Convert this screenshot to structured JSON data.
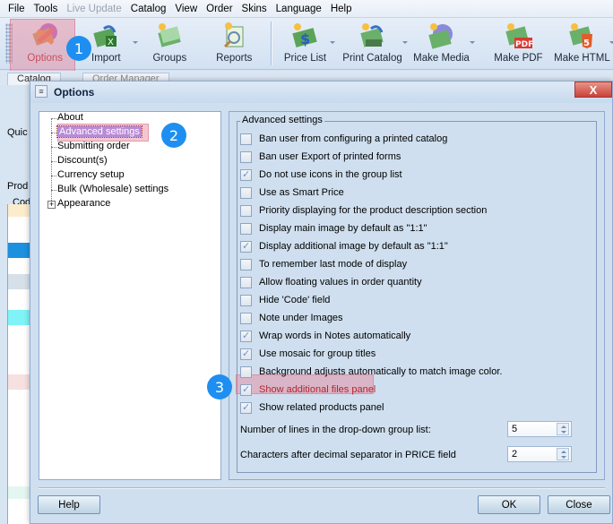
{
  "menubar": {
    "items": [
      {
        "label": "File",
        "enabled": true
      },
      {
        "label": "Tools",
        "enabled": true
      },
      {
        "label": "Live Update",
        "enabled": false
      },
      {
        "label": "Catalog",
        "enabled": true
      },
      {
        "label": "View",
        "enabled": true
      },
      {
        "label": "Order",
        "enabled": true
      },
      {
        "label": "Skins",
        "enabled": true
      },
      {
        "label": "Language",
        "enabled": true
      },
      {
        "label": "Help",
        "enabled": true
      }
    ]
  },
  "toolbar": {
    "buttons": [
      {
        "label": "Options",
        "icon": "options-icon"
      },
      {
        "label": "Import",
        "icon": "import-icon"
      },
      {
        "label": "Groups",
        "icon": "groups-icon"
      },
      {
        "label": "Reports",
        "icon": "reports-icon"
      },
      {
        "label": "Price List",
        "icon": "price-list-icon"
      },
      {
        "label": "Print Catalog",
        "icon": "print-catalog-icon"
      },
      {
        "label": "Make Media",
        "icon": "make-media-icon"
      },
      {
        "label": "Make PDF",
        "icon": "make-pdf-icon"
      },
      {
        "label": "Make HTML",
        "icon": "make-html-icon"
      }
    ]
  },
  "tabs": [
    "Catalog",
    "Order Manager"
  ],
  "background": {
    "quick_label": "Quic",
    "products_label": "Prod",
    "code_header": "Cod"
  },
  "badges": [
    "1",
    "2",
    "3"
  ],
  "dialog": {
    "title": "Options",
    "tree": [
      {
        "label": "About",
        "selected": false
      },
      {
        "label": "Advanced settings",
        "selected": true
      },
      {
        "label": "Submitting order",
        "selected": false
      },
      {
        "label": "Discount(s)",
        "selected": false
      },
      {
        "label": "Currency setup",
        "selected": false
      },
      {
        "label": "Bulk (Wholesale) settings",
        "selected": false
      },
      {
        "label": "Appearance",
        "selected": false,
        "expandable": true
      }
    ],
    "group_title": "Advanced settings",
    "options": [
      {
        "label": "Ban user from configuring a printed catalog",
        "checked": false
      },
      {
        "label": "Ban user Export of printed forms",
        "checked": false
      },
      {
        "label": "Do not use icons in the group list",
        "checked": true
      },
      {
        "label": "Use as Smart Price",
        "checked": false
      },
      {
        "label": "Priority displaying for the product description section",
        "checked": false
      },
      {
        "label": "Display main image by default as \"1:1\"",
        "checked": false
      },
      {
        "label": "Display additional image by default as \"1:1\"",
        "checked": true
      },
      {
        "label": "To remember last mode of display",
        "checked": false
      },
      {
        "label": "Allow floating values in order quantity",
        "checked": false
      },
      {
        "label": "Hide 'Code' field",
        "checked": false
      },
      {
        "label": "Note under Images",
        "checked": false
      },
      {
        "label": "Wrap words in Notes automatically",
        "checked": true
      },
      {
        "label": "Use mosaic for group titles",
        "checked": true
      },
      {
        "label": "Background adjusts automatically to match image color.",
        "checked": false
      },
      {
        "label": "Show additional files panel",
        "checked": true,
        "highlighted": true
      },
      {
        "label": "Show related products panel",
        "checked": true
      }
    ],
    "numeric": [
      {
        "label": "Number of lines in the drop-down group list:",
        "value": "5"
      },
      {
        "label": "Characters after decimal separator in PRICE field",
        "value": "2"
      }
    ],
    "buttons": {
      "help": "Help",
      "ok": "OK",
      "close": "Close"
    },
    "close_glyph": "X"
  },
  "colors": {
    "accent": "#1e8ff0",
    "highlight": "#e78296",
    "selected_bg": "#b88bd6",
    "close_btn": "#c8423a"
  }
}
